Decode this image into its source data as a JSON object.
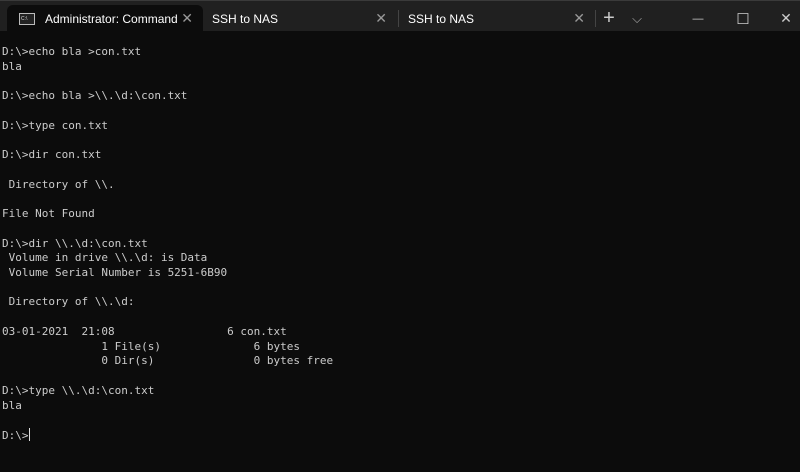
{
  "tabs": [
    {
      "label": "Administrator: Command Prompt",
      "icon": "cmd-icon",
      "active": true
    },
    {
      "label": "SSH to NAS",
      "active": false
    },
    {
      "label": "SSH to NAS",
      "active": false
    }
  ],
  "window_controls": {
    "new_tab": "+",
    "dropdown": "⌵",
    "minimize": "—",
    "maximize": "☐",
    "close": "✕"
  },
  "terminal": {
    "lines": [
      "D:\\>echo bla >con.txt",
      "bla",
      "",
      "D:\\>echo bla >\\\\.\\d:\\con.txt",
      "",
      "D:\\>type con.txt",
      "",
      "D:\\>dir con.txt",
      "",
      " Directory of \\\\.",
      "",
      "File Not Found",
      "",
      "D:\\>dir \\\\.\\d:\\con.txt",
      " Volume in drive \\\\.\\d: is Data",
      " Volume Serial Number is 5251-6B90",
      "",
      " Directory of \\\\.\\d:",
      "",
      "03-01-2021  21:08                 6 con.txt",
      "               1 File(s)              6 bytes",
      "               0 Dir(s)               0 bytes free",
      "",
      "D:\\>type \\\\.\\d:\\con.txt",
      "bla",
      ""
    ],
    "prompt": "D:\\>"
  },
  "colors": {
    "background": "#0c0c0c",
    "foreground": "#cccccc",
    "titlebar": "#202020"
  }
}
